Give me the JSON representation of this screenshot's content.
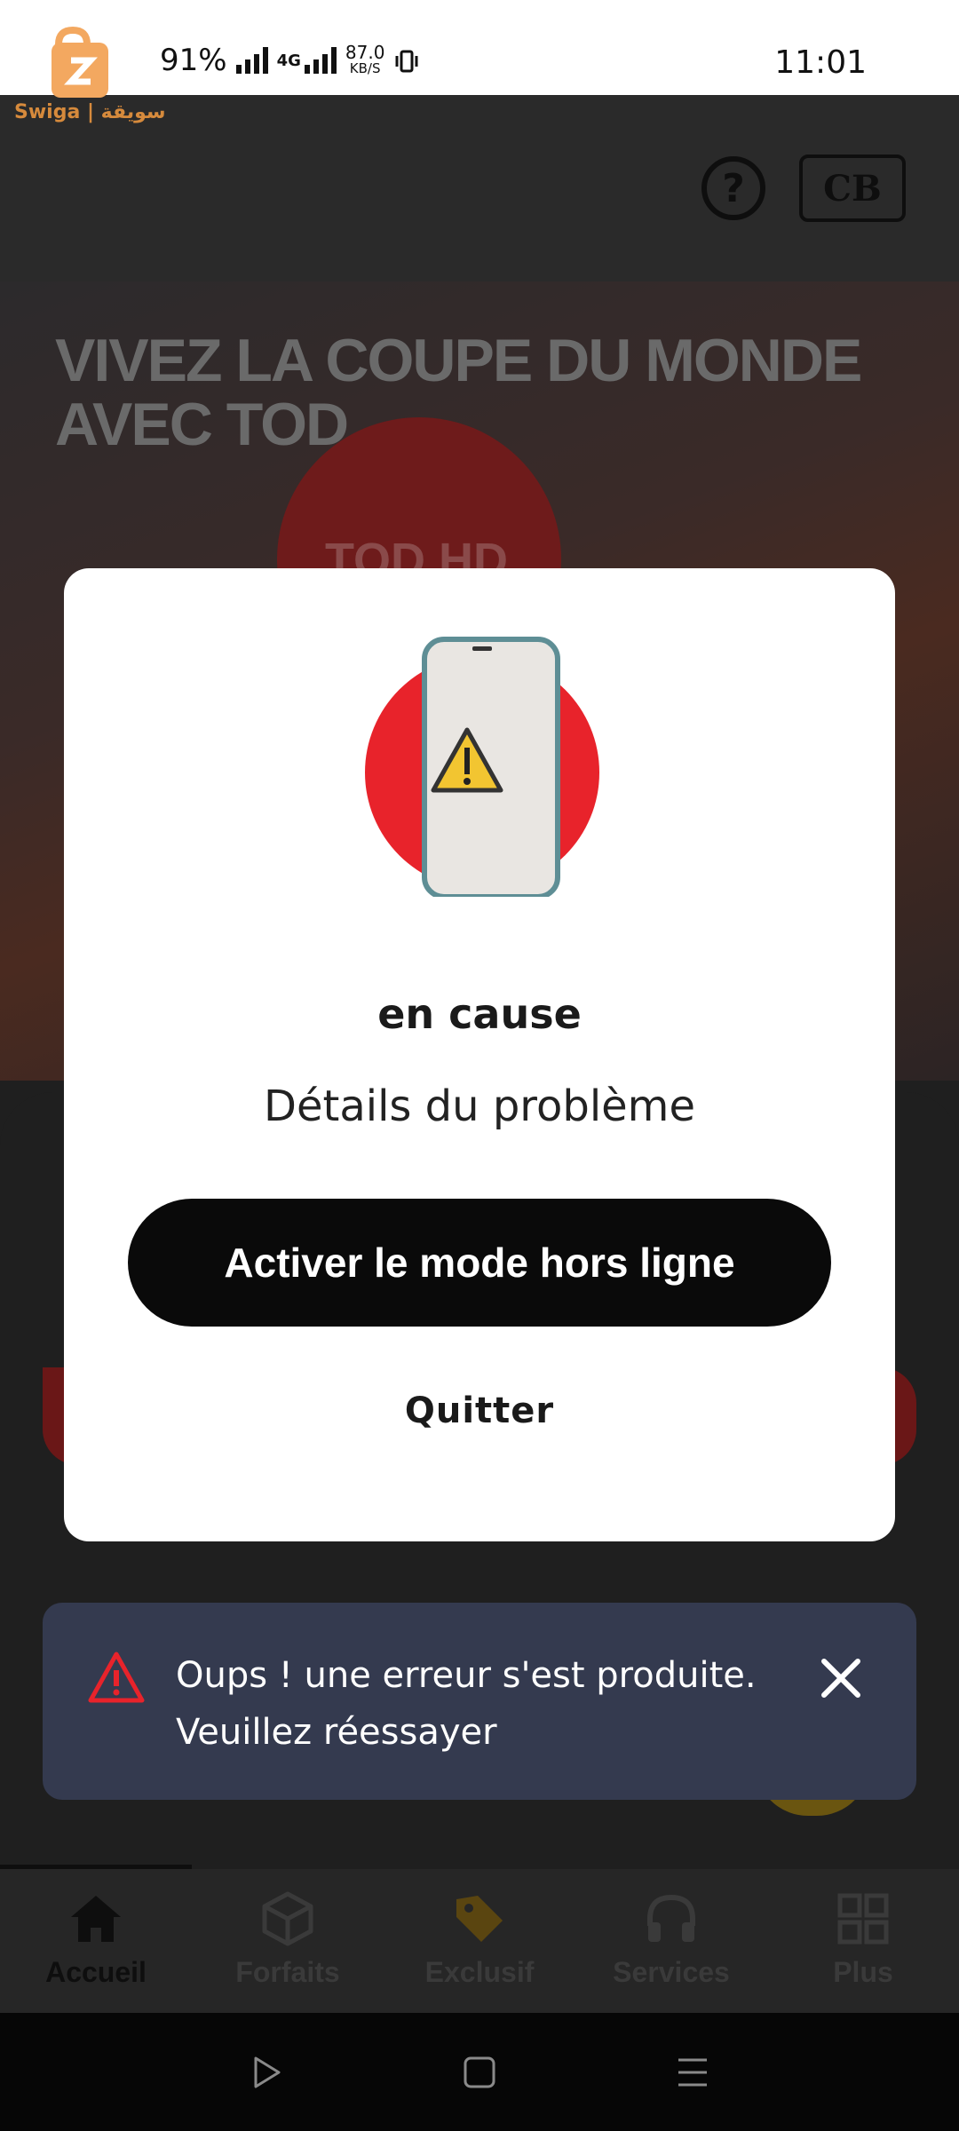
{
  "status_bar": {
    "battery": "91%",
    "network": "4G",
    "speed_value": "87.0",
    "speed_unit": "KB/S",
    "time": "11:01"
  },
  "watermark": {
    "text": "Swiga | سويقة"
  },
  "header": {
    "help_icon": "question-circle-icon",
    "badge_text": "CB"
  },
  "banner": {
    "title": "VIVEZ LA COUPE DU MONDE AVEC TOD",
    "sub": "TOD HD"
  },
  "modal": {
    "illustration": "phone-warning-icon",
    "title": "en cause",
    "subtitle": "Détails du problème",
    "primary_button": "Activer le mode hors ligne",
    "secondary_button": "Quitter"
  },
  "toast": {
    "icon": "warning-triangle-icon",
    "message": "Oups ! une erreur s'est produite. Veuillez réessayer",
    "close_icon": "close-icon"
  },
  "bottom_nav": {
    "items": [
      {
        "label": "Accueil",
        "icon": "home-icon",
        "active": true
      },
      {
        "label": "Forfaits",
        "icon": "package-icon",
        "active": false
      },
      {
        "label": "Exclusif",
        "icon": "tag-icon",
        "active": false
      },
      {
        "label": "Services",
        "icon": "headphones-icon",
        "active": false
      },
      {
        "label": "Plus",
        "icon": "grid-icon",
        "active": false
      }
    ]
  },
  "colors": {
    "accent_red": "#e8232b",
    "toast_bg": "#343a4f",
    "button_bg": "#0a0a0a",
    "warning_yellow": "#f2c531"
  }
}
